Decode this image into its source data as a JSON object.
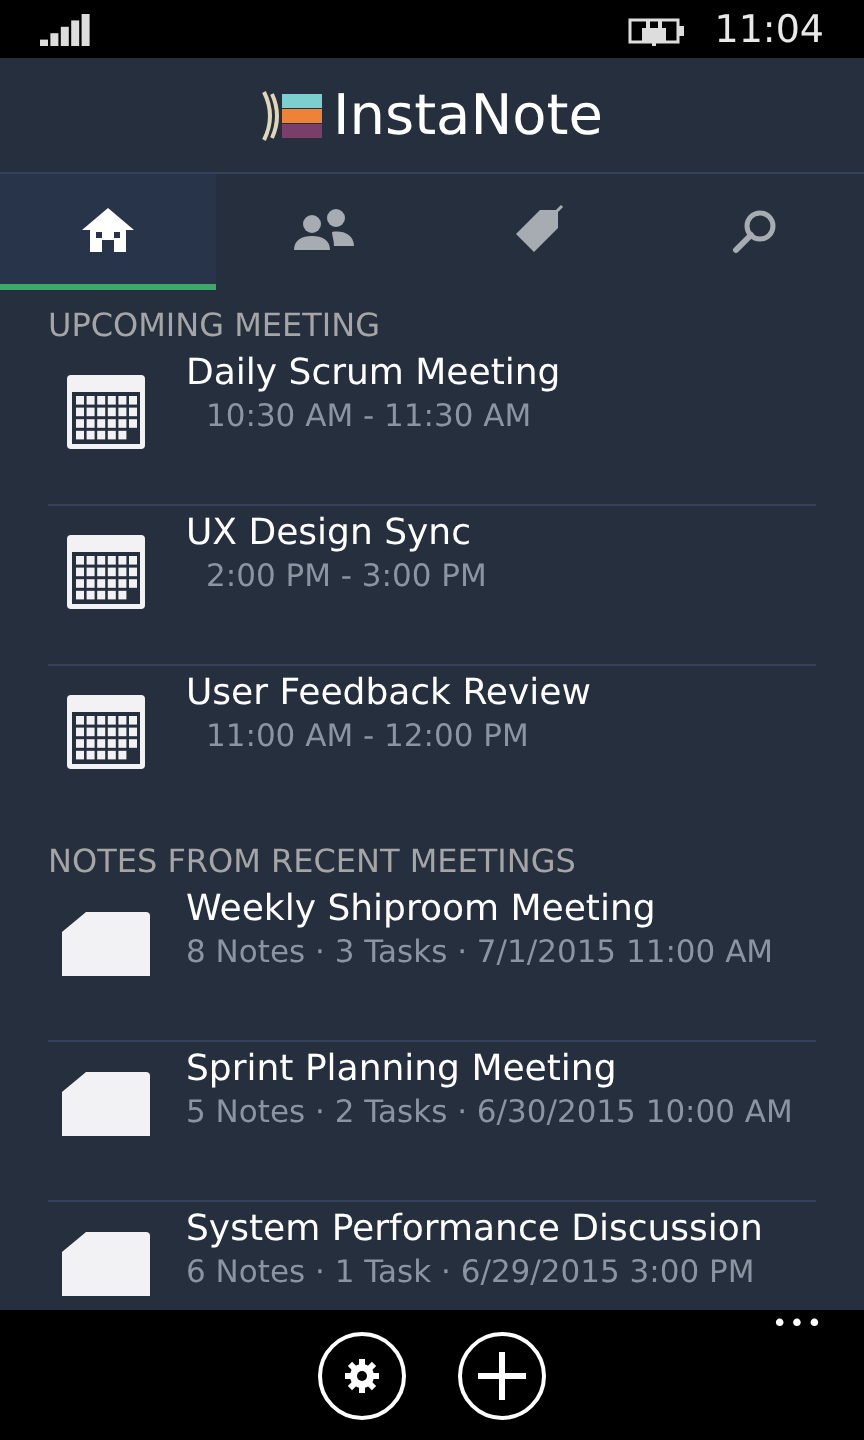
{
  "status_bar": {
    "time": "11:04"
  },
  "header": {
    "title": "InstaNote"
  },
  "tabs": [
    {
      "kind": "home",
      "selected": true
    },
    {
      "kind": "people",
      "selected": false
    },
    {
      "kind": "tag",
      "selected": false
    },
    {
      "kind": "search",
      "selected": false
    }
  ],
  "upcoming": {
    "heading": "UPCOMING MEETING",
    "items": [
      {
        "title": "Daily Scrum Meeting",
        "time": "10:30 AM - 11:30 AM"
      },
      {
        "title": "UX Design Sync",
        "time": "2:00 PM - 3:00 PM"
      },
      {
        "title": "User Feedback Review",
        "time": "11:00 AM - 12:00 PM"
      }
    ]
  },
  "recent": {
    "heading": "NOTES FROM RECENT MEETINGS",
    "items": [
      {
        "title": "Weekly Shiproom Meeting",
        "details": "8 Notes · 3 Tasks · 7/1/2015 11:00 AM"
      },
      {
        "title": "Sprint Planning Meeting",
        "details": "5 Notes · 2 Tasks · 6/30/2015 10:00 AM"
      },
      {
        "title": "System Performance Discussion",
        "details": "6 Notes · 1 Task · 6/29/2015 3:00 PM"
      }
    ]
  },
  "app_bar": {
    "buttons": [
      {
        "kind": "settings"
      },
      {
        "kind": "add"
      }
    ],
    "more": "•••"
  }
}
